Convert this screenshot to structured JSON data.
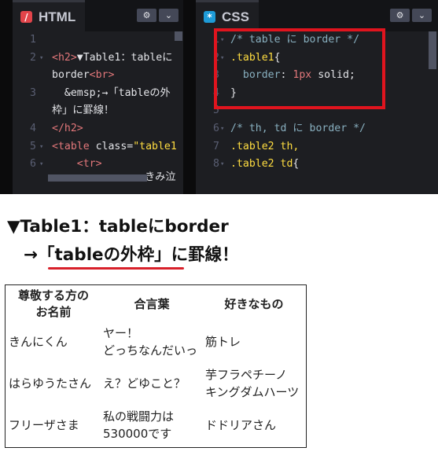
{
  "html_pane": {
    "title": "HTML",
    "icon": "/",
    "icon_color": "#e2444a",
    "lines": [
      {
        "n": "1",
        "parts": []
      },
      {
        "n": "2",
        "fold": true,
        "parts": [
          {
            "c": "c-tag",
            "t": "<h2>"
          },
          {
            "c": "c-text",
            "t": "▼Table1：tableに"
          }
        ]
      },
      {
        "n": "",
        "parts": [
          {
            "c": "c-text",
            "t": "border"
          },
          {
            "c": "c-tag",
            "t": "<br>"
          }
        ]
      },
      {
        "n": "3",
        "parts": [
          {
            "c": "c-amp",
            "t": "  &emsp;→「tableの外"
          }
        ]
      },
      {
        "n": "",
        "parts": [
          {
            "c": "c-text",
            "t": "枠」に罫線！"
          }
        ]
      },
      {
        "n": "4",
        "parts": [
          {
            "c": "c-tag",
            "t": "</h2>"
          }
        ]
      },
      {
        "n": "5",
        "fold": true,
        "parts": [
          {
            "c": "c-tag",
            "t": "<table "
          },
          {
            "c": "c-attr",
            "t": "class="
          },
          {
            "c": "c-str",
            "t": "\"table1"
          }
        ]
      },
      {
        "n": "6",
        "fold": true,
        "parts": [
          {
            "c": "c-tag",
            "t": "    <tr>"
          }
        ]
      }
    ],
    "partial_last": "きみ泣"
  },
  "css_pane": {
    "title": "CSS",
    "icon": "*",
    "icon_color": "#1e9bd7",
    "lines": [
      {
        "n": "1",
        "fold": true,
        "parts": [
          {
            "c": "c-com",
            "t": "/* table に border */"
          }
        ]
      },
      {
        "n": "2",
        "fold": true,
        "parts": [
          {
            "c": "c-sel",
            "t": ".table1"
          },
          {
            "c": "c-text",
            "t": "{"
          }
        ]
      },
      {
        "n": "3",
        "parts": [
          {
            "c": "c-prop",
            "t": "  border"
          },
          {
            "c": "c-text",
            "t": ": "
          },
          {
            "c": "c-num",
            "t": "1px"
          },
          {
            "c": "c-kw",
            "t": " solid;"
          }
        ]
      },
      {
        "n": "4",
        "parts": [
          {
            "c": "c-text",
            "t": "}"
          }
        ]
      },
      {
        "n": "5",
        "parts": []
      },
      {
        "n": "6",
        "fold": true,
        "parts": [
          {
            "c": "c-com",
            "t": "/* th, td に border */"
          }
        ]
      },
      {
        "n": "7",
        "parts": [
          {
            "c": "c-sel",
            "t": ".table2 th,"
          }
        ]
      },
      {
        "n": "8",
        "fold": true,
        "parts": [
          {
            "c": "c-sel",
            "t": ".table2 td"
          },
          {
            "c": "c-text",
            "t": "{"
          }
        ]
      }
    ]
  },
  "highlight_color": "#e0141e",
  "output": {
    "heading_line1": "▼Table1：tableにborder",
    "heading_line2": "→「tableの外枠」に罫線！",
    "table": {
      "headers": [
        "尊敬する方の\nお名前",
        "合言葉",
        "好きなもの"
      ],
      "rows": [
        [
          "きんにくん",
          "ヤー！\nどっちなんだいっ",
          "筋トレ"
        ],
        [
          "はらゆうたさん",
          "え？どゆこと？",
          "芋フラペチーノ\nキングダムハーツ"
        ],
        [
          "フリーザさま",
          "私の戦闘力は\n530000です",
          "ドドリアさん"
        ]
      ]
    }
  }
}
